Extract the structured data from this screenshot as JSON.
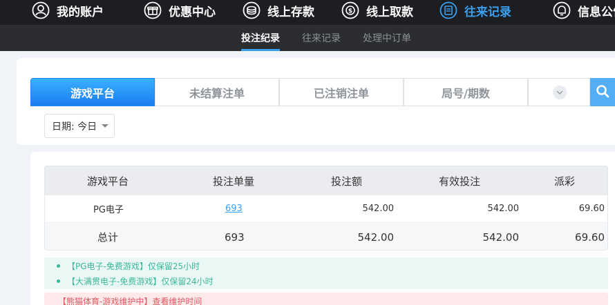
{
  "top_nav": {
    "items": [
      {
        "label": "我的账户",
        "icon": "user-icon"
      },
      {
        "label": "优惠中心",
        "icon": "gift-icon"
      },
      {
        "label": "线上存款",
        "icon": "deposit-icon"
      },
      {
        "label": "线上取款",
        "icon": "withdraw-icon"
      },
      {
        "label": "往来记录",
        "icon": "records-icon",
        "active": true
      },
      {
        "label": "信息公告",
        "icon": "bell-icon"
      }
    ]
  },
  "sub_nav": {
    "items": [
      {
        "label": "投注纪录",
        "active": true
      },
      {
        "label": "往来记录"
      },
      {
        "label": "处理中订单"
      }
    ]
  },
  "filter": {
    "tabs": [
      {
        "label": "游戏平台",
        "active": true
      },
      {
        "label": "未结算注单"
      },
      {
        "label": "已注销注单"
      },
      {
        "label": "局号/期数"
      }
    ],
    "date_label": "日期: 今日"
  },
  "table": {
    "headers": [
      "游戏平台",
      "投注单量",
      "投注额",
      "有效投注",
      "派彩"
    ],
    "rows": [
      {
        "platform": "PG电子",
        "count": "693",
        "amount": "542.00",
        "valid": "542.00",
        "payout": "69.60"
      }
    ],
    "total": {
      "label": "总计",
      "count": "693",
      "amount": "542.00",
      "valid": "542.00",
      "payout": "69.60"
    }
  },
  "notices": [
    "【PG电子-免费游戏】仅保留25小时",
    "【大满贯电子-免费游戏】仅保留24小时"
  ],
  "alert": "【熊猫体育-游戏维护中】查看维护时间",
  "colors": {
    "accent": "#3aa0f0",
    "nav_bg": "#1c1e22",
    "notice_text": "#39b79c",
    "alert_text": "#e05a63"
  }
}
